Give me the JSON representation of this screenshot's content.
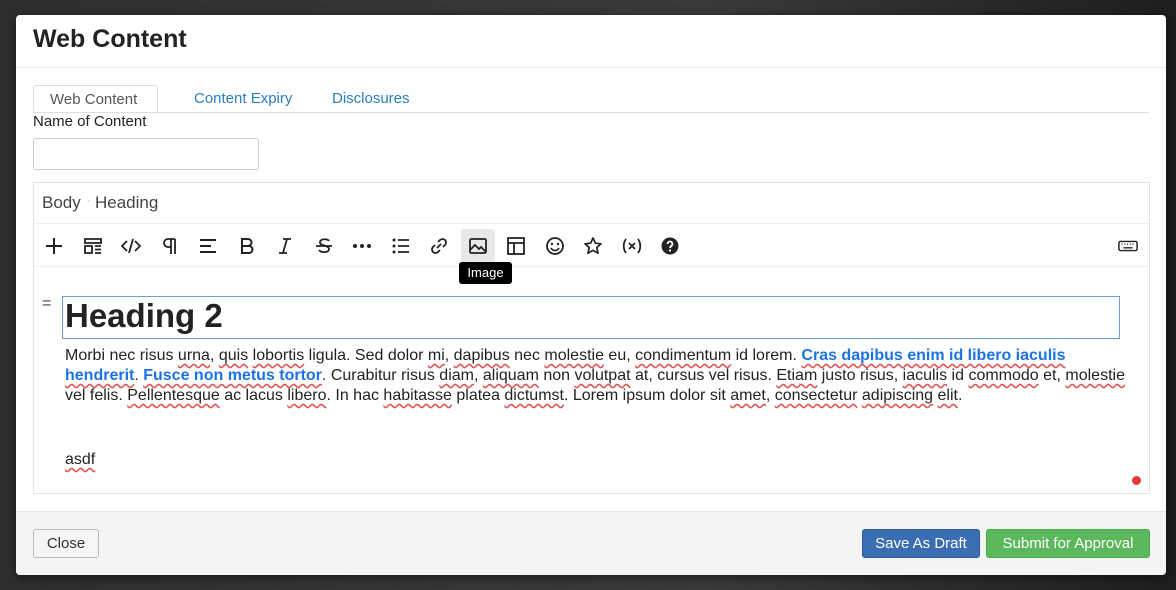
{
  "modal": {
    "title": "Web Content"
  },
  "tabs": [
    {
      "label": "Web Content",
      "active": true
    },
    {
      "label": "Content Expiry",
      "active": false
    },
    {
      "label": "Disclosures",
      "active": false
    }
  ],
  "name_field": {
    "label": "Name of Content",
    "value": "",
    "placeholder": ""
  },
  "editor": {
    "breadcrumb": [
      "Body",
      "Heading"
    ],
    "toolbar": [
      {
        "icon": "plus-icon",
        "label": "Insert"
      },
      {
        "icon": "layout-icon",
        "label": "Layout"
      },
      {
        "icon": "code-icon",
        "label": "Code"
      },
      {
        "icon": "paragraph-icon",
        "label": "Paragraph"
      },
      {
        "icon": "align-icon",
        "label": "Align"
      },
      {
        "icon": "bold-icon",
        "label": "Bold"
      },
      {
        "icon": "italic-icon",
        "label": "Italic"
      },
      {
        "icon": "strikethrough-icon",
        "label": "Strikethrough"
      },
      {
        "icon": "more-icon",
        "label": "More"
      },
      {
        "icon": "list-icon",
        "label": "List"
      },
      {
        "icon": "link-icon",
        "label": "Link"
      },
      {
        "icon": "image-icon",
        "label": "Image"
      },
      {
        "icon": "table-icon",
        "label": "Table"
      },
      {
        "icon": "emoji-icon",
        "label": "Emoji"
      },
      {
        "icon": "star-icon",
        "label": "Special"
      },
      {
        "icon": "variable-icon",
        "label": "Variable"
      },
      {
        "icon": "help-icon",
        "label": "Help"
      },
      {
        "icon": "keyboard-icon",
        "label": "Keyboard"
      }
    ],
    "tooltip": "Image",
    "heading": "Heading 2",
    "paragraph": {
      "t1": "Morbi nec risus ",
      "w_urna": "urna",
      "t2": ", ",
      "w_quis": "quis",
      "t3": " ",
      "w_lobortis": "lobortis",
      "t4": " ligula. Sed dolor ",
      "w_mi": "mi",
      "t5": ", ",
      "w_dapibus": "dapibus",
      "t6": " nec ",
      "w_molestie": "molestie",
      "t7": " eu, ",
      "w_condimentum": "condimentum",
      "t8": " id lorem. ",
      "link1": "Cras dapibus enim id libero iaculis hendrerit",
      "t9": ". ",
      "link2": "Fusce non metus tortor",
      "t10": ". Curabitur risus ",
      "w_diam": "diam",
      "t11": ", ",
      "w_aliquam": "aliquam",
      "t12": " non ",
      "w_volutpat": "volutpat",
      "t13": " at, cursus vel risus. ",
      "w_etiam": "Etiam",
      "t14": " justo risus, ",
      "w_iaculis": "iaculis",
      "t15": " id ",
      "w_commodo": "commodo",
      "t16": " et, ",
      "w_molestie2": "molestie",
      "t17": " vel felis. ",
      "w_pellentesque": "Pellentesque",
      "t18": " ac lacus ",
      "w_libero": "libero",
      "t19": ". In hac ",
      "w_habitasse": "habitasse",
      "t20": " platea ",
      "w_dictumst": "dictumst",
      "t21": ". Lorem ipsum dolor sit ",
      "w_amet": "amet",
      "t22": ", ",
      "w_consectetur": "consectetur",
      "t23": " ",
      "w_adipiscing": "adipiscing",
      "t24": " ",
      "w_elit": "elit",
      "t25": "."
    },
    "extra_text": "asdf",
    "drag_handle": "="
  },
  "footer": {
    "close_label": "Close",
    "draft_label": "Save As Draft",
    "submit_label": "Submit for Approval"
  },
  "colors": {
    "primary": "#3b6db3",
    "success": "#5cb85c",
    "link": "#1a73e8",
    "tab_link": "#2a7fbf",
    "spell_error": "#e05555"
  }
}
